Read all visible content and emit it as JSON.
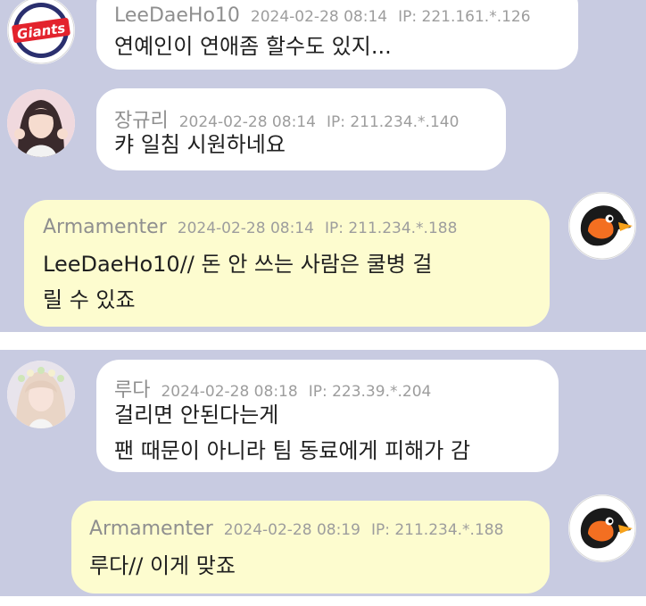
{
  "messages": [
    {
      "nick": "LeeDaeHo10",
      "timestamp": "2024-02-28 08:14",
      "ip": "IP: 221.161.*.126",
      "lines": [
        "연예인이 연애좀 할수도 있지..."
      ],
      "avatar_icon": "giants-logo-avatar",
      "avatar_text": "Giants"
    },
    {
      "nick": "장규리",
      "timestamp": "2024-02-28 08:14",
      "ip": "IP: 211.234.*.140",
      "lines": [
        "캬 일침 시원하네요"
      ],
      "avatar_icon": "user-photo-avatar"
    },
    {
      "nick": "Armamenter",
      "timestamp": "2024-02-28 08:14",
      "ip": "IP: 211.234.*.188",
      "lines": [
        "LeeDaeHo10// 돈 안 쓰는 사람은 쿨병 걸",
        "릴 수 있죠"
      ],
      "avatar_icon": "oriole-bird-avatar"
    },
    {
      "nick": "루다",
      "timestamp": "2024-02-28 08:18",
      "ip": "IP: 223.39.*.204",
      "lines": [
        "걸리면 안된다는게",
        "팬 때문이 아니라 팀 동료에게 피해가 감"
      ],
      "avatar_icon": "user-photo-avatar"
    },
    {
      "nick": "Armamenter",
      "timestamp": "2024-02-28 08:19",
      "ip": "IP: 211.234.*.188",
      "lines": [
        "루다// 이게 맞죠"
      ],
      "avatar_icon": "oriole-bird-avatar"
    }
  ],
  "colors": {
    "background": "#c8cbe1",
    "bubble_other": "#ffffff",
    "bubble_self": "#fdfccf",
    "meta_text": "#9a9a9a"
  }
}
